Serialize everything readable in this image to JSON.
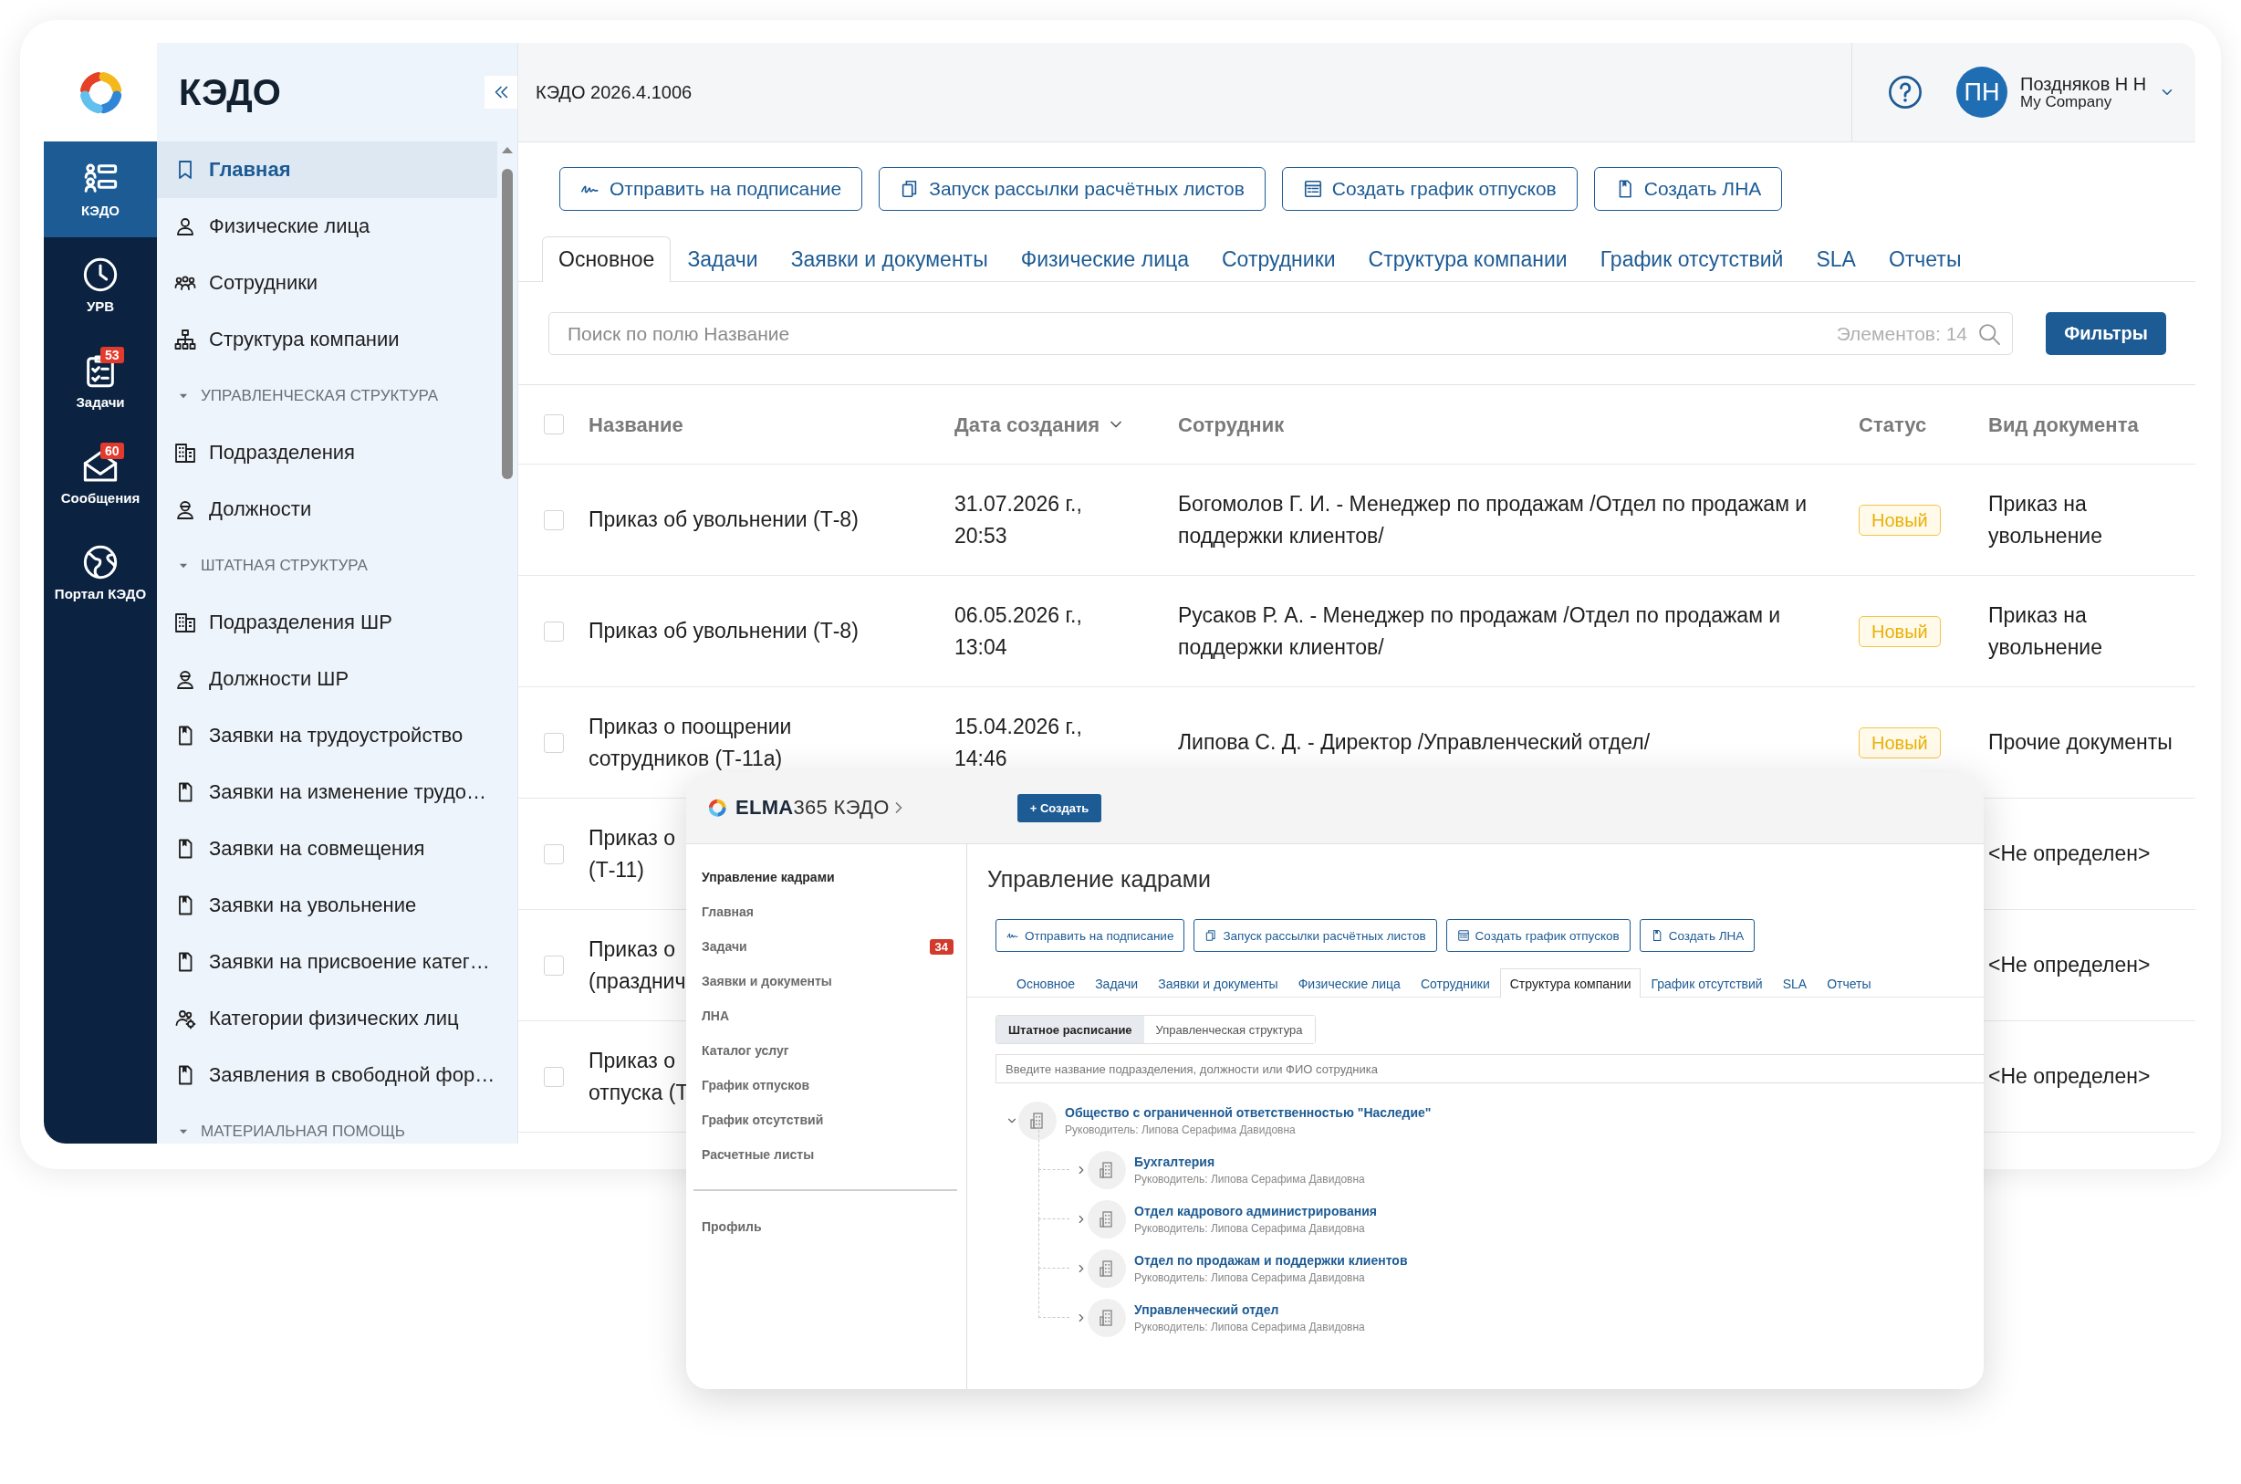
{
  "rail": {
    "items": [
      {
        "label": "КЭДО",
        "selected": true
      },
      {
        "label": "УРВ",
        "selected": false
      },
      {
        "label": "Задачи",
        "selected": false,
        "badge": "53"
      },
      {
        "label": "Сообщения",
        "selected": false,
        "badge": "60"
      },
      {
        "label": "Портал КЭДО",
        "selected": false
      }
    ]
  },
  "sidebar": {
    "title": "КЭДО",
    "items": [
      {
        "kind": "link",
        "label": "Главная",
        "selected": true
      },
      {
        "kind": "link",
        "label": "Физические лица",
        "selected": false
      },
      {
        "kind": "link",
        "label": "Сотрудники",
        "selected": false
      },
      {
        "kind": "link",
        "label": "Структура компании",
        "selected": false
      },
      {
        "kind": "section",
        "label": "УПРАВЛЕНЧЕСКАЯ СТРУКТУРА",
        "expanded": true
      },
      {
        "kind": "link",
        "label": "Подразделения",
        "selected": false
      },
      {
        "kind": "link",
        "label": "Должности",
        "selected": false
      },
      {
        "kind": "section",
        "label": "ШТАТНАЯ СТРУКТУРА",
        "expanded": true
      },
      {
        "kind": "link",
        "label": "Подразделения ШР",
        "selected": false
      },
      {
        "kind": "link",
        "label": "Должности ШР",
        "selected": false
      },
      {
        "kind": "link",
        "label": "Заявки на трудоустройство",
        "selected": false
      },
      {
        "kind": "link",
        "label": "Заявки на изменение трудо…",
        "selected": false
      },
      {
        "kind": "link",
        "label": "Заявки на совмещения",
        "selected": false
      },
      {
        "kind": "link",
        "label": "Заявки на увольнение",
        "selected": false
      },
      {
        "kind": "link",
        "label": "Заявки на присвоение катег…",
        "selected": false
      },
      {
        "kind": "link",
        "label": "Категории физических лиц",
        "selected": false
      },
      {
        "kind": "link",
        "label": "Заявления в свободной фор…",
        "selected": false
      },
      {
        "kind": "section",
        "label": "МАТЕРИАЛЬНАЯ ПОМОЩЬ",
        "expanded": true
      }
    ]
  },
  "header": {
    "version": "КЭДО 2026.4.1006",
    "user": {
      "initials": "ПН",
      "name": "Поздняков Н Н",
      "company": "My Company"
    }
  },
  "toolbar": {
    "buttons": [
      "Отправить на подписание",
      "Запуск рассылки расчётных листов",
      "Создать график отпусков",
      "Создать ЛНА"
    ]
  },
  "tabs": [
    {
      "label": "Основное",
      "selected": true
    },
    {
      "label": "Задачи",
      "selected": false
    },
    {
      "label": "Заявки и документы",
      "selected": false
    },
    {
      "label": "Физические лица",
      "selected": false
    },
    {
      "label": "Сотрудники",
      "selected": false
    },
    {
      "label": "Структура компании",
      "selected": false
    },
    {
      "label": "График отсутствий",
      "selected": false
    },
    {
      "label": "SLA",
      "selected": false
    },
    {
      "label": "Отчеты",
      "selected": false
    }
  ],
  "search": {
    "placeholder": "Поиск по полю Название",
    "count": "Элементов: 14"
  },
  "filter_button": "Фильтры",
  "table": {
    "select_all": {
      "checked": false
    },
    "columns": [
      "Название",
      "Дата создания",
      "Сотрудник",
      "Статус",
      "Вид документа"
    ],
    "rows": [
      {
        "checked": false,
        "name": "Приказ об увольнении (Т-8)",
        "date": "31.07.2026 г., 20:53",
        "employee": "Богомолов Г. И. - Менеджер по продажам /Отдел по продажам и поддержки клиентов/",
        "status": "Новый",
        "doc_type": "Приказ на увольнение"
      },
      {
        "checked": false,
        "name": "Приказ об увольнении (Т-8)",
        "date": "06.05.2026 г., 13:04",
        "employee": "Русаков Р. А. - Менеджер по продажам /Отдел по продажам и поддержки клиентов/",
        "status": "Новый",
        "doc_type": "Приказ на увольнение"
      },
      {
        "checked": false,
        "name": "Приказ о поощрении сотрудников (Т-11а)",
        "date": "15.04.2026 г., 14:46",
        "employee": "Липова С. Д. - Директор /Управленческий отдел/",
        "status": "Новый",
        "doc_type": "Прочие документы"
      },
      {
        "checked": false,
        "name": "Приказ о\n(Т-11)",
        "doc_type": "<Не определен>"
      },
      {
        "checked": false,
        "name": "Приказ о\n(празднич",
        "doc_type": "<Не определен>"
      },
      {
        "checked": false,
        "name": "Приказ о\nотпуска (Т",
        "doc_type": "<Не определен>"
      }
    ]
  },
  "overlay": {
    "product": "**ELMA**365 КЭДО",
    "create_button": "+ Создать",
    "nav": [
      {
        "kind": "heading",
        "label": "Управление кадрами"
      },
      {
        "kind": "link",
        "label": "Главная"
      },
      {
        "kind": "link",
        "label": "Задачи",
        "badge": "34"
      },
      {
        "kind": "link",
        "label": "Заявки и документы"
      },
      {
        "kind": "link",
        "label": "ЛНА"
      },
      {
        "kind": "link",
        "label": "Каталог услуг"
      },
      {
        "kind": "link",
        "label": "График отпусков"
      },
      {
        "kind": "link",
        "label": "График отсутствий"
      },
      {
        "kind": "link",
        "label": "Расчетные листы"
      }
    ],
    "profile": "Профиль",
    "title": "Управление кадрами",
    "buttons": [
      "Отправить на подписание",
      "Запуск рассылки расчётных листов",
      "Создать график отпусков",
      "Создать ЛНА"
    ],
    "tabs": [
      {
        "label": "Основное",
        "selected": false
      },
      {
        "label": "Задачи",
        "selected": false
      },
      {
        "label": "Заявки и документы",
        "selected": false
      },
      {
        "label": "Физические лица",
        "selected": false
      },
      {
        "label": "Сотрудники",
        "selected": false
      },
      {
        "label": "Структура компании",
        "selected": true
      },
      {
        "label": "График отсутствий",
        "selected": false
      },
      {
        "label": "SLA",
        "selected": false
      },
      {
        "label": "Отчеты",
        "selected": false
      }
    ],
    "segments": [
      {
        "label": "Штатное расписание",
        "selected": true
      },
      {
        "label": "Управленческая структура",
        "selected": false
      }
    ],
    "search": {
      "placeholder": "Введите название подразделения, должности или ФИО сотрудника"
    },
    "tree": [
      {
        "name": "Общество с ограниченной ответственностью \"Наследие\"",
        "manager": "Руководитель: Липова Серафима Давидовна",
        "expanded": true,
        "children": [
          {
            "name": "Бухгалтерия",
            "manager": "Руководитель: Липова Серафима Давидовна",
            "expanded": false
          },
          {
            "name": "Отдел кадрового администрирования",
            "manager": "Руководитель: Липова Серафима Давидовна",
            "expanded": false
          },
          {
            "name": "Отдел по продажам и поддержки клиентов",
            "manager": "Руководитель: Липова Серафима Давидовна",
            "expanded": false
          },
          {
            "name": "Управленческий отдел",
            "manager": "Руководитель: Липова Серафима Давидовна",
            "expanded": false
          }
        ]
      }
    ]
  }
}
